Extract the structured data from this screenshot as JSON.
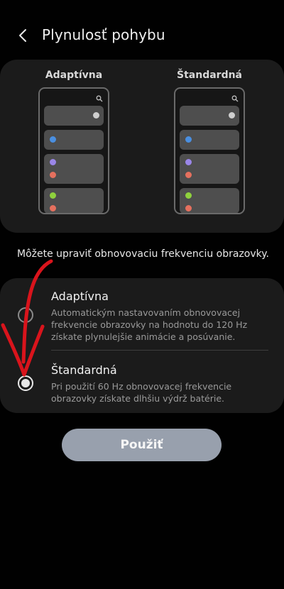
{
  "header": {
    "title": "Plynulosť pohybu"
  },
  "preview": {
    "left_label": "Adaptívna",
    "right_label": "Štandardná"
  },
  "description": "Môžete upraviť obnovovaciu frekvenciu obrazovky.",
  "options": [
    {
      "title": "Adaptívna",
      "subtitle": "Automatickým nastavovaním obnovovacej frekvencie obrazovky na hodnotu do 120 Hz získate plynulejšie animácie a posúvanie.",
      "selected": false
    },
    {
      "title": "Štandardná",
      "subtitle": "Pri použití 60 Hz obnovovacej frekvencie obrazovky získate dlhšiu výdrž batérie.",
      "selected": true
    }
  ],
  "apply_button": "Použiť",
  "colors": {
    "background": "#010101",
    "card": "#1b1b1b",
    "button": "#98a0ad",
    "annotation_arrow": "#d9141c"
  },
  "icons": {
    "back": "chevron-left-icon",
    "search": "search-icon",
    "annotation": "red-arrow-annotation"
  }
}
